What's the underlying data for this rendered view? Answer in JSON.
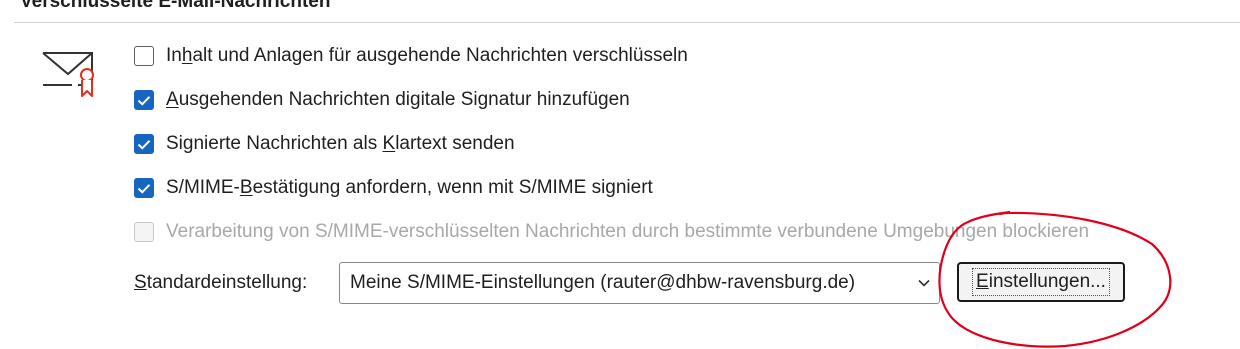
{
  "section": {
    "title": "Verschlüsselte E-Mail-Nachrichten"
  },
  "icons": {
    "envelope": "envelope-certificate-icon",
    "check": "checkmark-icon",
    "chevron": "chevron-down-icon"
  },
  "colors": {
    "accent": "#1665c0",
    "annotation": "#e0001a",
    "disabled_text": "#a8a8a8"
  },
  "options": [
    {
      "pre": "In",
      "key": "h",
      "post": "alt und Anlagen für ausgehende Nachrichten verschlüsseln",
      "checked": false,
      "disabled": false
    },
    {
      "pre": "",
      "key": "A",
      "post": "usgehenden Nachrichten digitale Signatur hinzufügen",
      "checked": true,
      "disabled": false
    },
    {
      "pre": "Signierte Nachrichten als ",
      "key": "K",
      "post": "lartext senden",
      "checked": true,
      "disabled": false
    },
    {
      "pre": "S/MIME-",
      "key": "B",
      "post": "estätigung anfordern, wenn mit S/MIME signiert",
      "checked": true,
      "disabled": false
    },
    {
      "pre": "Verarbeitung von S/MIME-verschlüsselten Nachrichten durch bestimmte verbundene Umgebungen blockieren",
      "key": "",
      "post": "",
      "checked": false,
      "disabled": true
    }
  ],
  "default_setting": {
    "label_key": "S",
    "label_rest": "tandardeinstellung:",
    "selected": "Meine S/MIME-Einstellungen (rauter@dhbw-ravensburg.de)",
    "button_key": "E",
    "button_rest": "instellungen..."
  }
}
